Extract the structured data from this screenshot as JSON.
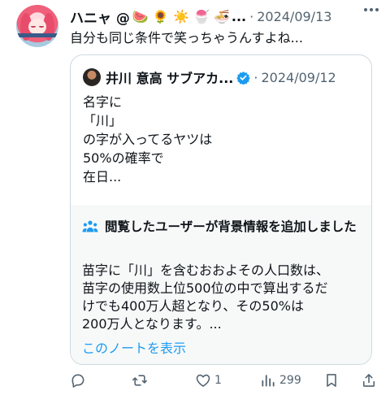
{
  "post": {
    "author_name": "ハニャ @",
    "name_emojis": "🍉 🌻 ☀️ 🍧 🍜",
    "truncation": "...",
    "separator": "·",
    "timestamp": "2024/09/13",
    "text": "自分も同じ条件で笑っちゃうんすよね..."
  },
  "quote": {
    "author_name": "井川 意高 サブアカ...",
    "separator": "·",
    "timestamp": "2024/09/12",
    "lines": [
      "名字に",
      "「川」",
      "の字が入ってるヤツは",
      "50%の確率で",
      "在日..."
    ]
  },
  "community_note": {
    "title": "閲覧したユーザーが背景情報を追加しました",
    "lines": [
      "苗字に「川」を含むおおよその人口数は、",
      "苗字の使用数上位500位の中で算出するだ",
      "けでも400万人超となり、その50%は",
      "200万人となります。..."
    ],
    "link": "このノートを表示"
  },
  "actions": {
    "reply_count": "",
    "repost_count": "",
    "like_count": "1",
    "view_count": "299"
  },
  "colors": {
    "accent": "#1d9bf0",
    "text": "#0f1419",
    "muted": "#536471",
    "border": "#cfd9de",
    "note_bg": "#f7f9f9"
  },
  "icons": [
    "more-icon",
    "verified-icon",
    "people-icon",
    "reply-icon",
    "repost-icon",
    "like-icon",
    "views-icon",
    "bookmark-icon",
    "share-icon"
  ]
}
